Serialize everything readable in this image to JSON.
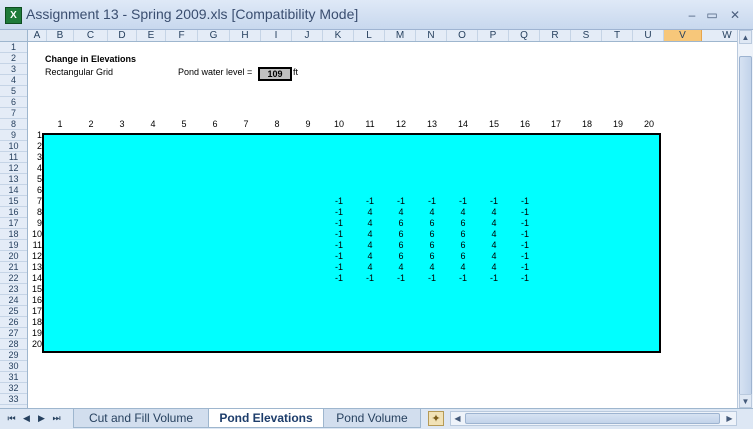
{
  "window": {
    "title": "Assignment 13 - Spring 2009.xls  [Compatibility Mode]",
    "app_icon_letter": "X",
    "minimize_glyph": "–",
    "restore_glyph": "▭",
    "close_glyph": "✕"
  },
  "sheet": {
    "column_headers": [
      "A",
      "B",
      "C",
      "D",
      "E",
      "F",
      "G",
      "H",
      "I",
      "J",
      "K",
      "L",
      "M",
      "N",
      "O",
      "P",
      "Q",
      "R",
      "S",
      "T",
      "U",
      "V",
      "W"
    ],
    "selected_column": "V",
    "row_numbers": [
      1,
      2,
      3,
      4,
      5,
      6,
      7,
      8,
      9,
      10,
      11,
      12,
      13,
      14,
      15,
      16,
      17,
      18,
      19,
      20,
      21,
      22,
      23,
      24,
      25,
      26,
      27,
      28,
      29,
      30,
      31,
      32,
      33
    ],
    "heading": "Change in Elevations",
    "subheading": "Rectangular Grid",
    "pond_label": "Pond water level =",
    "pond_value": "109",
    "pond_unit": "ft",
    "grid_col_labels": [
      "1",
      "2",
      "3",
      "4",
      "5",
      "6",
      "7",
      "8",
      "9",
      "10",
      "11",
      "12",
      "13",
      "14",
      "15",
      "16",
      "17",
      "18",
      "19",
      "20"
    ],
    "grid_row_labels": [
      "1",
      "2",
      "3",
      "4",
      "5",
      "6",
      "7",
      "8",
      "9",
      "10",
      "11",
      "12",
      "13",
      "14",
      "15",
      "16",
      "17",
      "18",
      "19",
      "20"
    ],
    "grid_fill_color": "#00ffff",
    "values_start_col": 10,
    "values_start_row": 7,
    "grid_values": [
      [
        "-1",
        "-1",
        "-1",
        "-1",
        "-1",
        "-1",
        "-1"
      ],
      [
        "-1",
        "4",
        "4",
        "4",
        "4",
        "4",
        "-1"
      ],
      [
        "-1",
        "4",
        "6",
        "6",
        "6",
        "4",
        "-1"
      ],
      [
        "-1",
        "4",
        "6",
        "6",
        "6",
        "4",
        "-1"
      ],
      [
        "-1",
        "4",
        "6",
        "6",
        "6",
        "4",
        "-1"
      ],
      [
        "-1",
        "4",
        "6",
        "6",
        "6",
        "4",
        "-1"
      ],
      [
        "-1",
        "4",
        "4",
        "4",
        "4",
        "4",
        "-1"
      ],
      [
        "-1",
        "-1",
        "-1",
        "-1",
        "-1",
        "-1",
        "-1"
      ]
    ]
  },
  "tabs": {
    "nav_first": "⏮",
    "nav_prev": "◀",
    "nav_next": "▶",
    "nav_last": "⏭",
    "items": [
      {
        "label": "Cut and Fill Volume",
        "active": false
      },
      {
        "label": "Pond Elevations",
        "active": true
      },
      {
        "label": "Pond Volume",
        "active": false
      }
    ],
    "insert_sheet_glyph": "✦"
  },
  "scroll": {
    "up_glyph": "▲",
    "down_glyph": "▼",
    "left_glyph": "◀",
    "right_glyph": "▶"
  }
}
